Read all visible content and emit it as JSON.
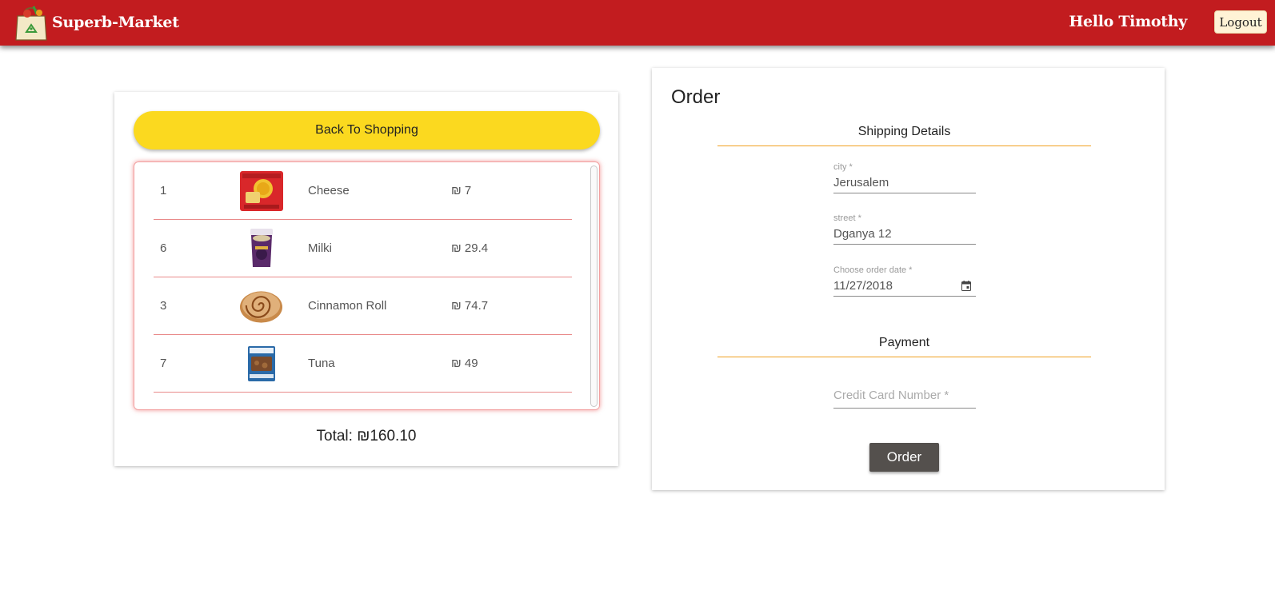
{
  "header": {
    "brand": "Superb-Market",
    "logo_icon": "grocery-bag-icon",
    "greeting": "Hello Timothy",
    "logout_label": "Logout",
    "brand_color": "#c21c1f"
  },
  "cart": {
    "back_label": "Back To Shopping",
    "back_color": "#fbd91f",
    "items": [
      {
        "qty": "1",
        "name": "Cheese",
        "price": "₪ 7",
        "image": "cheese-package-icon"
      },
      {
        "qty": "6",
        "name": "Milki",
        "price": "₪ 29.4",
        "image": "milki-cup-icon"
      },
      {
        "qty": "3",
        "name": "Cinnamon Roll",
        "price": "₪ 74.7",
        "image": "cinnamon-roll-icon"
      },
      {
        "qty": "7",
        "name": "Tuna",
        "price": "₪ 49",
        "image": "tuna-can-icon"
      }
    ],
    "total": "Total: ₪160.10"
  },
  "order": {
    "title": "Order",
    "shipping_title": "Shipping Details",
    "city": {
      "label": "city *",
      "value": "Jerusalem"
    },
    "street": {
      "label": "street *",
      "value": "Dganya 12"
    },
    "date": {
      "label": "Choose order date *",
      "value": "11/27/2018",
      "icon": "calendar-icon"
    },
    "payment_title": "Payment",
    "credit_card_placeholder": "Credit Card Number *",
    "order_button": "Order"
  }
}
